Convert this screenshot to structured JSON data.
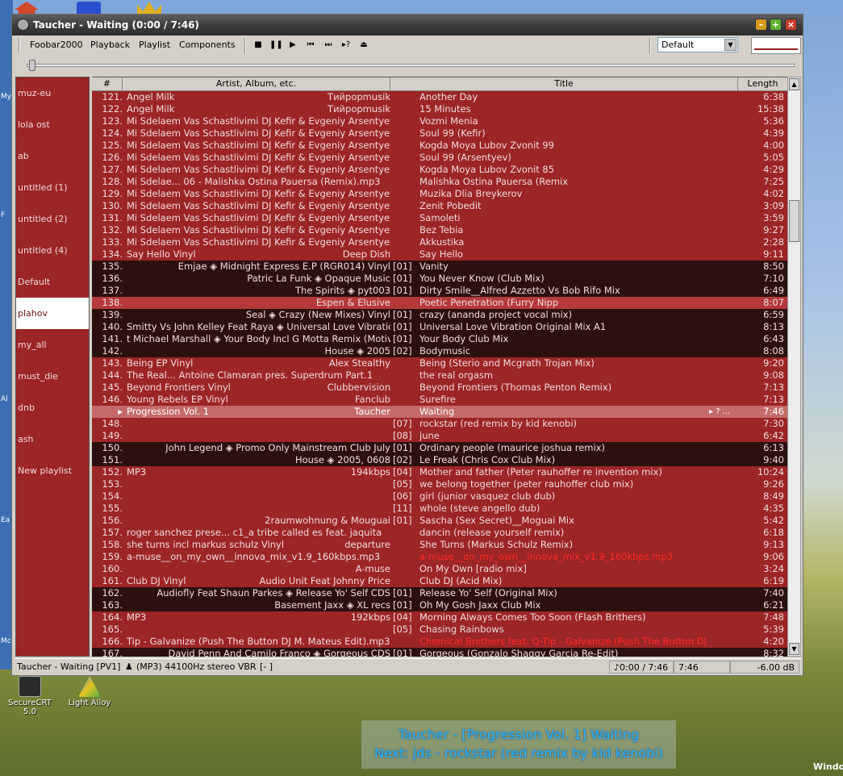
{
  "window": {
    "title": "Taucher - Waiting (0:00 / 7:46)"
  },
  "menu": [
    "Foobar2000",
    "Playback",
    "Playlist",
    "Components"
  ],
  "toolbar_icons": [
    "stop-icon",
    "pause-icon",
    "play-icon",
    "previous-icon",
    "next-icon",
    "random-icon",
    "open-icon"
  ],
  "toolbar_glyphs": [
    "■",
    "❚❚",
    "▶",
    "⏮",
    "⏭",
    "▸?",
    "⏏"
  ],
  "layout_select": "Default",
  "playlists": [
    "muz-eu",
    "lola ost",
    "ab",
    "untitled (1)",
    "untitled (2)",
    "untitled (4)",
    "Default",
    "plahov",
    "my_all",
    "must_die",
    "dnb",
    "ash",
    "New playlist"
  ],
  "selected_playlist": "plahov",
  "columns": {
    "num": "#",
    "artist": "Artist, Album, etc.",
    "title": "Title",
    "length": "Length"
  },
  "rows": [
    {
      "n": "121.",
      "a": "Angel Milk",
      "m": "Тийрорmusik",
      "t": "Another Day",
      "l": "6:38",
      "s": "a"
    },
    {
      "n": "122.",
      "a": "Angel Milk",
      "m": "Тийрорmusik",
      "t": "15 Minutes",
      "l": "15:38",
      "s": "a"
    },
    {
      "n": "123.",
      "a": "Mi Sdelaem Vas Schastlivimi DJ Kefir & Evgeniy Arsentyev",
      "t": "Vozmi Menia",
      "l": "5:36",
      "s": "a"
    },
    {
      "n": "124.",
      "a": "Mi Sdelaem Vas Schastlivimi DJ Kefir & Evgeniy Arsentyev",
      "t": "Soul 99 (Kefir)",
      "l": "4:39",
      "s": "a"
    },
    {
      "n": "125.",
      "a": "Mi Sdelaem Vas Schastlivimi DJ Kefir & Evgeniy Arsentyev",
      "t": "Kogda Moya Lubov Zvonit 99",
      "l": "4:00",
      "s": "a"
    },
    {
      "n": "126.",
      "a": "Mi Sdelaem Vas Schastlivimi DJ Kefir & Evgeniy Arsentyev",
      "t": "Soul 99 (Arsentyev)",
      "l": "5:05",
      "s": "a"
    },
    {
      "n": "127.",
      "a": "Mi Sdelaem Vas Schastlivimi DJ Kefir & Evgeniy Arsentyev",
      "t": "Kogda Moya Lubov Zvonit 85",
      "l": "4:29",
      "s": "a"
    },
    {
      "n": "128.",
      "a": "Mi Sdelae... 06 - Malishka Ostina Pauersa (Remix).mp3",
      "t": "Malishka Ostina Pauersa (Remix",
      "l": "7:25",
      "s": "a"
    },
    {
      "n": "129.",
      "a": "Mi Sdelaem Vas Schastlivimi DJ Kefir & Evgeniy Arsentyev",
      "t": "Muzika Dlia Breykerov",
      "l": "4:02",
      "s": "a"
    },
    {
      "n": "130.",
      "a": "Mi Sdelaem Vas Schastlivimi DJ Kefir & Evgeniy Arsentyev",
      "t": "Zenit Pobedit",
      "l": "3:09",
      "s": "a"
    },
    {
      "n": "131.",
      "a": "Mi Sdelaem Vas Schastlivimi DJ Kefir & Evgeniy Arsentyev",
      "t": "Samoleti",
      "l": "3:59",
      "s": "a"
    },
    {
      "n": "132.",
      "a": "Mi Sdelaem Vas Schastlivimi DJ Kefir & Evgeniy Arsentyev",
      "t": "Bez Tebia",
      "l": "9:27",
      "s": "a"
    },
    {
      "n": "133.",
      "a": "Mi Sdelaem Vas Schastlivimi DJ Kefir & Evgeniy Arsentyev",
      "t": "Akkustika",
      "l": "2:28",
      "s": "a"
    },
    {
      "n": "134.",
      "a": "Say Hello Vinyl",
      "m": "Deep Dish",
      "t": "Say Hello",
      "l": "9:11",
      "s": "a"
    },
    {
      "n": "135.",
      "m": "Emjae ◈ Midnight Express E.P (RGR014) Vinyl",
      "k": "[01]",
      "t": "Vanity",
      "l": "8:50",
      "s": "b"
    },
    {
      "n": "136.",
      "m": "Patric La Funk ◈ Opaque Music",
      "k": "[01]",
      "t": "You Never Know (Club Mix)",
      "l": "7:10",
      "s": "b"
    },
    {
      "n": "137.",
      "m": "The Spirits ◈ pyt003",
      "k": "[01]",
      "t": "Dirty Smile__Alfred Azzetto Vs Bob Rifo Mix",
      "l": "6:49",
      "s": "b"
    },
    {
      "n": "138.",
      "m": "Espen & Elusive",
      "t": "Poetic Penetration (Furry Nipp",
      "l": "8:07",
      "s": "c"
    },
    {
      "n": "139.",
      "m": "Seal ◈ Crazy (New Mixes) Vinyl",
      "k": "[01]",
      "t": "crazy (ananda project vocal mix)",
      "l": "6:59",
      "s": "b"
    },
    {
      "n": "140.",
      "m": "Smitty Vs John Kelley Feat Raya ◈ Universal Love Vibration",
      "k": "[01]",
      "t": "Universal Love Vibration Original Mix A1",
      "l": "8:13",
      "s": "b"
    },
    {
      "n": "141.",
      "m": "t Michael Marshall ◈ Your Body Incl G Motta Remix (Motiv",
      "k": "[01]",
      "t": "Your Body Club Mix",
      "l": "6:43",
      "s": "b"
    },
    {
      "n": "142.",
      "m": "House ◈ 2005",
      "k": "[02]",
      "t": "Bodymusic",
      "l": "8:08",
      "s": "b"
    },
    {
      "n": "143.",
      "a": "Being EP Vinyl",
      "m": "Alex Stealthy",
      "t": "Being (Sterio and Mcgrath Trojan Mix)",
      "l": "9:20",
      "s": "a"
    },
    {
      "n": "144.",
      "a": "The Real... Antoine Clamaran pres. Superdrum Part.1",
      "t": "the real orgasm",
      "l": "9:08",
      "s": "a"
    },
    {
      "n": "145.",
      "a": "Beyond Frontiers Vinyl",
      "m": "Clubbervision",
      "t": "Beyond Frontiers (Thomas Penton Remix)",
      "l": "7:13",
      "s": "a"
    },
    {
      "n": "146.",
      "a": "Young Rebels EP Vinyl",
      "m": "Fanclub",
      "t": "Surefire",
      "l": "7:13",
      "s": "a"
    },
    {
      "n": "▸",
      "a": "Progression Vol. 1",
      "m": "Taucher",
      "t": "Waiting",
      "x": "▸  ?  ...",
      "l": "7:46",
      "s": "p"
    },
    {
      "n": "148.",
      "k": "[07]",
      "t": "rockstar (red remix by kid kenobi)",
      "l": "7:30",
      "s": "a"
    },
    {
      "n": "149.",
      "k": "[08]",
      "t": "june",
      "l": "6:42",
      "s": "a"
    },
    {
      "n": "150.",
      "m": "John Legend ◈ Promo Only Mainstream Club July",
      "k": "[01]",
      "t": "Ordinary people (maurice joshua remix)",
      "l": "6:13",
      "s": "b"
    },
    {
      "n": "151.",
      "m": "House ◈ 2005, 0608",
      "k": "[02]",
      "t": "Le Freak (Chris Cox Club Mix)",
      "l": "9:40",
      "s": "b"
    },
    {
      "n": "152.",
      "a": "MP3",
      "m": "194kbps",
      "k": "[04]",
      "t": "Mother and father (Peter rauhoffer re invention mix)",
      "l": "10:24",
      "s": "a"
    },
    {
      "n": "153.",
      "k": "[05]",
      "t": "we belong together (peter rauhoffer club mix)",
      "l": "9:26",
      "s": "a"
    },
    {
      "n": "154.",
      "k": "[06]",
      "t": "girl (junior vasquez club dub)",
      "l": "8:49",
      "s": "a"
    },
    {
      "n": "155.",
      "k": "[11]",
      "t": "whole (steve angello dub)",
      "l": "4:35",
      "s": "a"
    },
    {
      "n": "156.",
      "m": "2raumwohnung & Mouguai",
      "k": "[01]",
      "t": "Sascha (Sex Secret)__Moguai Mix",
      "l": "5:42",
      "s": "a"
    },
    {
      "n": "157.",
      "a": "roger sanchez prese... c1_a tribe called es feat. jaquita",
      "t": "dancin (release yourself remix)",
      "l": "6:18",
      "s": "a"
    },
    {
      "n": "158.",
      "a": "she turns incl markus schulz Vinyl",
      "m": "departure",
      "t": "She Turns (Markus Schulz Remix)",
      "l": "9:13",
      "s": "a"
    },
    {
      "n": "159.",
      "a": "a-muse__on_my_own__innova_mix_v1.9_160kbps.mp3",
      "t": "a-muse__on_my_own__innova_mix_v1.9_160kbps.mp3",
      "tr": true,
      "l": "9:06",
      "s": "a"
    },
    {
      "n": "160.",
      "m": "A-muse",
      "t": "On My Own [radio mix]",
      "l": "3:24",
      "s": "a"
    },
    {
      "n": "161.",
      "a": "Club DJ Vinyl",
      "m": "Audio Unit Feat Johnny Price",
      "t": "Club DJ (Acid Mix)",
      "l": "6:19",
      "s": "a"
    },
    {
      "n": "162.",
      "m": "Audiofly Feat Shaun Parkes ◈ Release Yo' Self CDS",
      "k": "[01]",
      "t": "Release Yo' Self (Original Mix)",
      "l": "7:40",
      "s": "b"
    },
    {
      "n": "163.",
      "m": "Basement Jaxx ◈ XL recs",
      "k": "[01]",
      "t": "Oh My Gosh  Jaxx Club Mix",
      "l": "6:21",
      "s": "b"
    },
    {
      "n": "164.",
      "a": "MP3",
      "m": "192kbps",
      "k": "[04]",
      "t": "Morning Always Comes Too Soon (Flash Brithers)",
      "l": "7:48",
      "s": "a"
    },
    {
      "n": "165.",
      "k": "[05]",
      "t": "Chasing Rainbows",
      "l": "5:39",
      "s": "a"
    },
    {
      "n": "166.",
      "a": "Tip - Galvanize (Push The Button DJ M. Mateus Edit).mp3",
      "t": "Chemical Brothers feat. Q-Tip - Galvanize (Push The Button DJ M...",
      "tr": true,
      "l": "4:20",
      "s": "a"
    },
    {
      "n": "167.",
      "m": "David Penn And Camilo Franco ◈ Gorgeous CDS",
      "k": "[01]",
      "t": "Gorgeous (Gonzalo Shaggy Garcia Re-Edit)",
      "l": "8:32",
      "s": "b"
    }
  ],
  "status": {
    "left": "Taucher - Waiting [PV1]",
    "format": "(MP3) 44100Hz stereo VBR",
    "mark": "[-  ]",
    "time": "♪0:00 / 7:46",
    "len": "7:46",
    "vol": "-6.00 dB"
  },
  "osd": {
    "line1": "Taucher - [Progression Vol. 1] Waiting",
    "line2": "Next: jds - rockstar (red remix by kid kenobi)"
  },
  "desktop": {
    "icon1": "SecureCRT 5.0",
    "icon2": "Light Alloy",
    "corner": "Windo"
  },
  "colors": {
    "playlist_bg": "#9c2526",
    "dark_row": "#2c1010",
    "playing_row": "#c46a6a",
    "osd_text": "#29b6ff"
  }
}
